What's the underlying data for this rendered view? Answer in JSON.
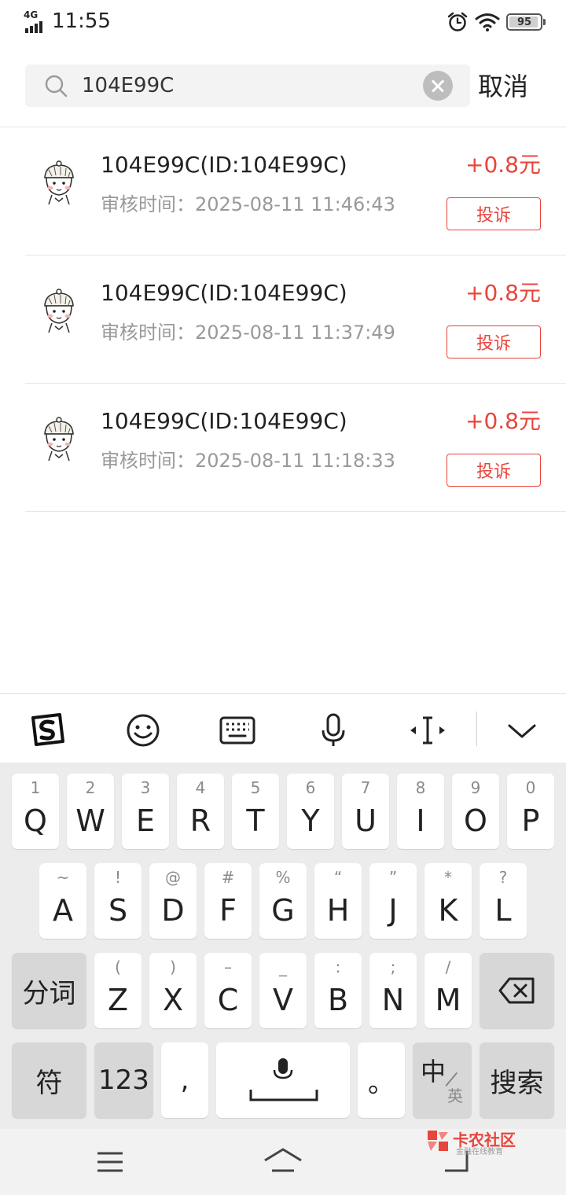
{
  "status_bar": {
    "network": "4G",
    "time": "11:55",
    "battery": "95"
  },
  "search": {
    "query": "104E99C",
    "cancel_label": "取消"
  },
  "results": [
    {
      "title": "104E99C(ID:104E99C)",
      "time_label": "审核时间：",
      "time": "2025-08-11 11:46:43",
      "amount": "+0.8元",
      "action": "投诉"
    },
    {
      "title": "104E99C(ID:104E99C)",
      "time_label": "审核时间：",
      "time": "2025-08-11 11:37:49",
      "amount": "+0.8元",
      "action": "投诉"
    },
    {
      "title": "104E99C(ID:104E99C)",
      "time_label": "审核时间：",
      "time": "2025-08-11 11:18:33",
      "amount": "+0.8元",
      "action": "投诉"
    }
  ],
  "keyboard": {
    "toolbar_icons": [
      "sogou-logo-icon",
      "emoji-icon",
      "keyboard-icon",
      "microphone-icon",
      "cursor-icon",
      "collapse-icon"
    ],
    "row1": [
      {
        "hint": "1",
        "key": "Q"
      },
      {
        "hint": "2",
        "key": "W"
      },
      {
        "hint": "3",
        "key": "E"
      },
      {
        "hint": "4",
        "key": "R"
      },
      {
        "hint": "5",
        "key": "T"
      },
      {
        "hint": "6",
        "key": "Y"
      },
      {
        "hint": "7",
        "key": "U"
      },
      {
        "hint": "8",
        "key": "I"
      },
      {
        "hint": "9",
        "key": "O"
      },
      {
        "hint": "0",
        "key": "P"
      }
    ],
    "row2": [
      {
        "hint": "~",
        "key": "A"
      },
      {
        "hint": "!",
        "key": "S"
      },
      {
        "hint": "@",
        "key": "D"
      },
      {
        "hint": "#",
        "key": "F"
      },
      {
        "hint": "%",
        "key": "G"
      },
      {
        "hint": "“",
        "key": "H"
      },
      {
        "hint": "”",
        "key": "J"
      },
      {
        "hint": "*",
        "key": "K"
      },
      {
        "hint": "?",
        "key": "L"
      }
    ],
    "row3": [
      {
        "hint": "(",
        "key": "Z"
      },
      {
        "hint": ")",
        "key": "X"
      },
      {
        "hint": "–",
        "key": "C"
      },
      {
        "hint": "_",
        "key": "V"
      },
      {
        "hint": ":",
        "key": "B"
      },
      {
        "hint": ";",
        "key": "N"
      },
      {
        "hint": "/",
        "key": "M"
      }
    ],
    "segment_label": "分词",
    "symbols_label": "符",
    "numbers_label": "123",
    "comma_label": ",",
    "period_label": "。",
    "lang_zh": "中",
    "lang_en": "英",
    "search_label": "搜索"
  },
  "watermark": {
    "title": "卡农社区",
    "subtitle": "金融在线教育"
  }
}
